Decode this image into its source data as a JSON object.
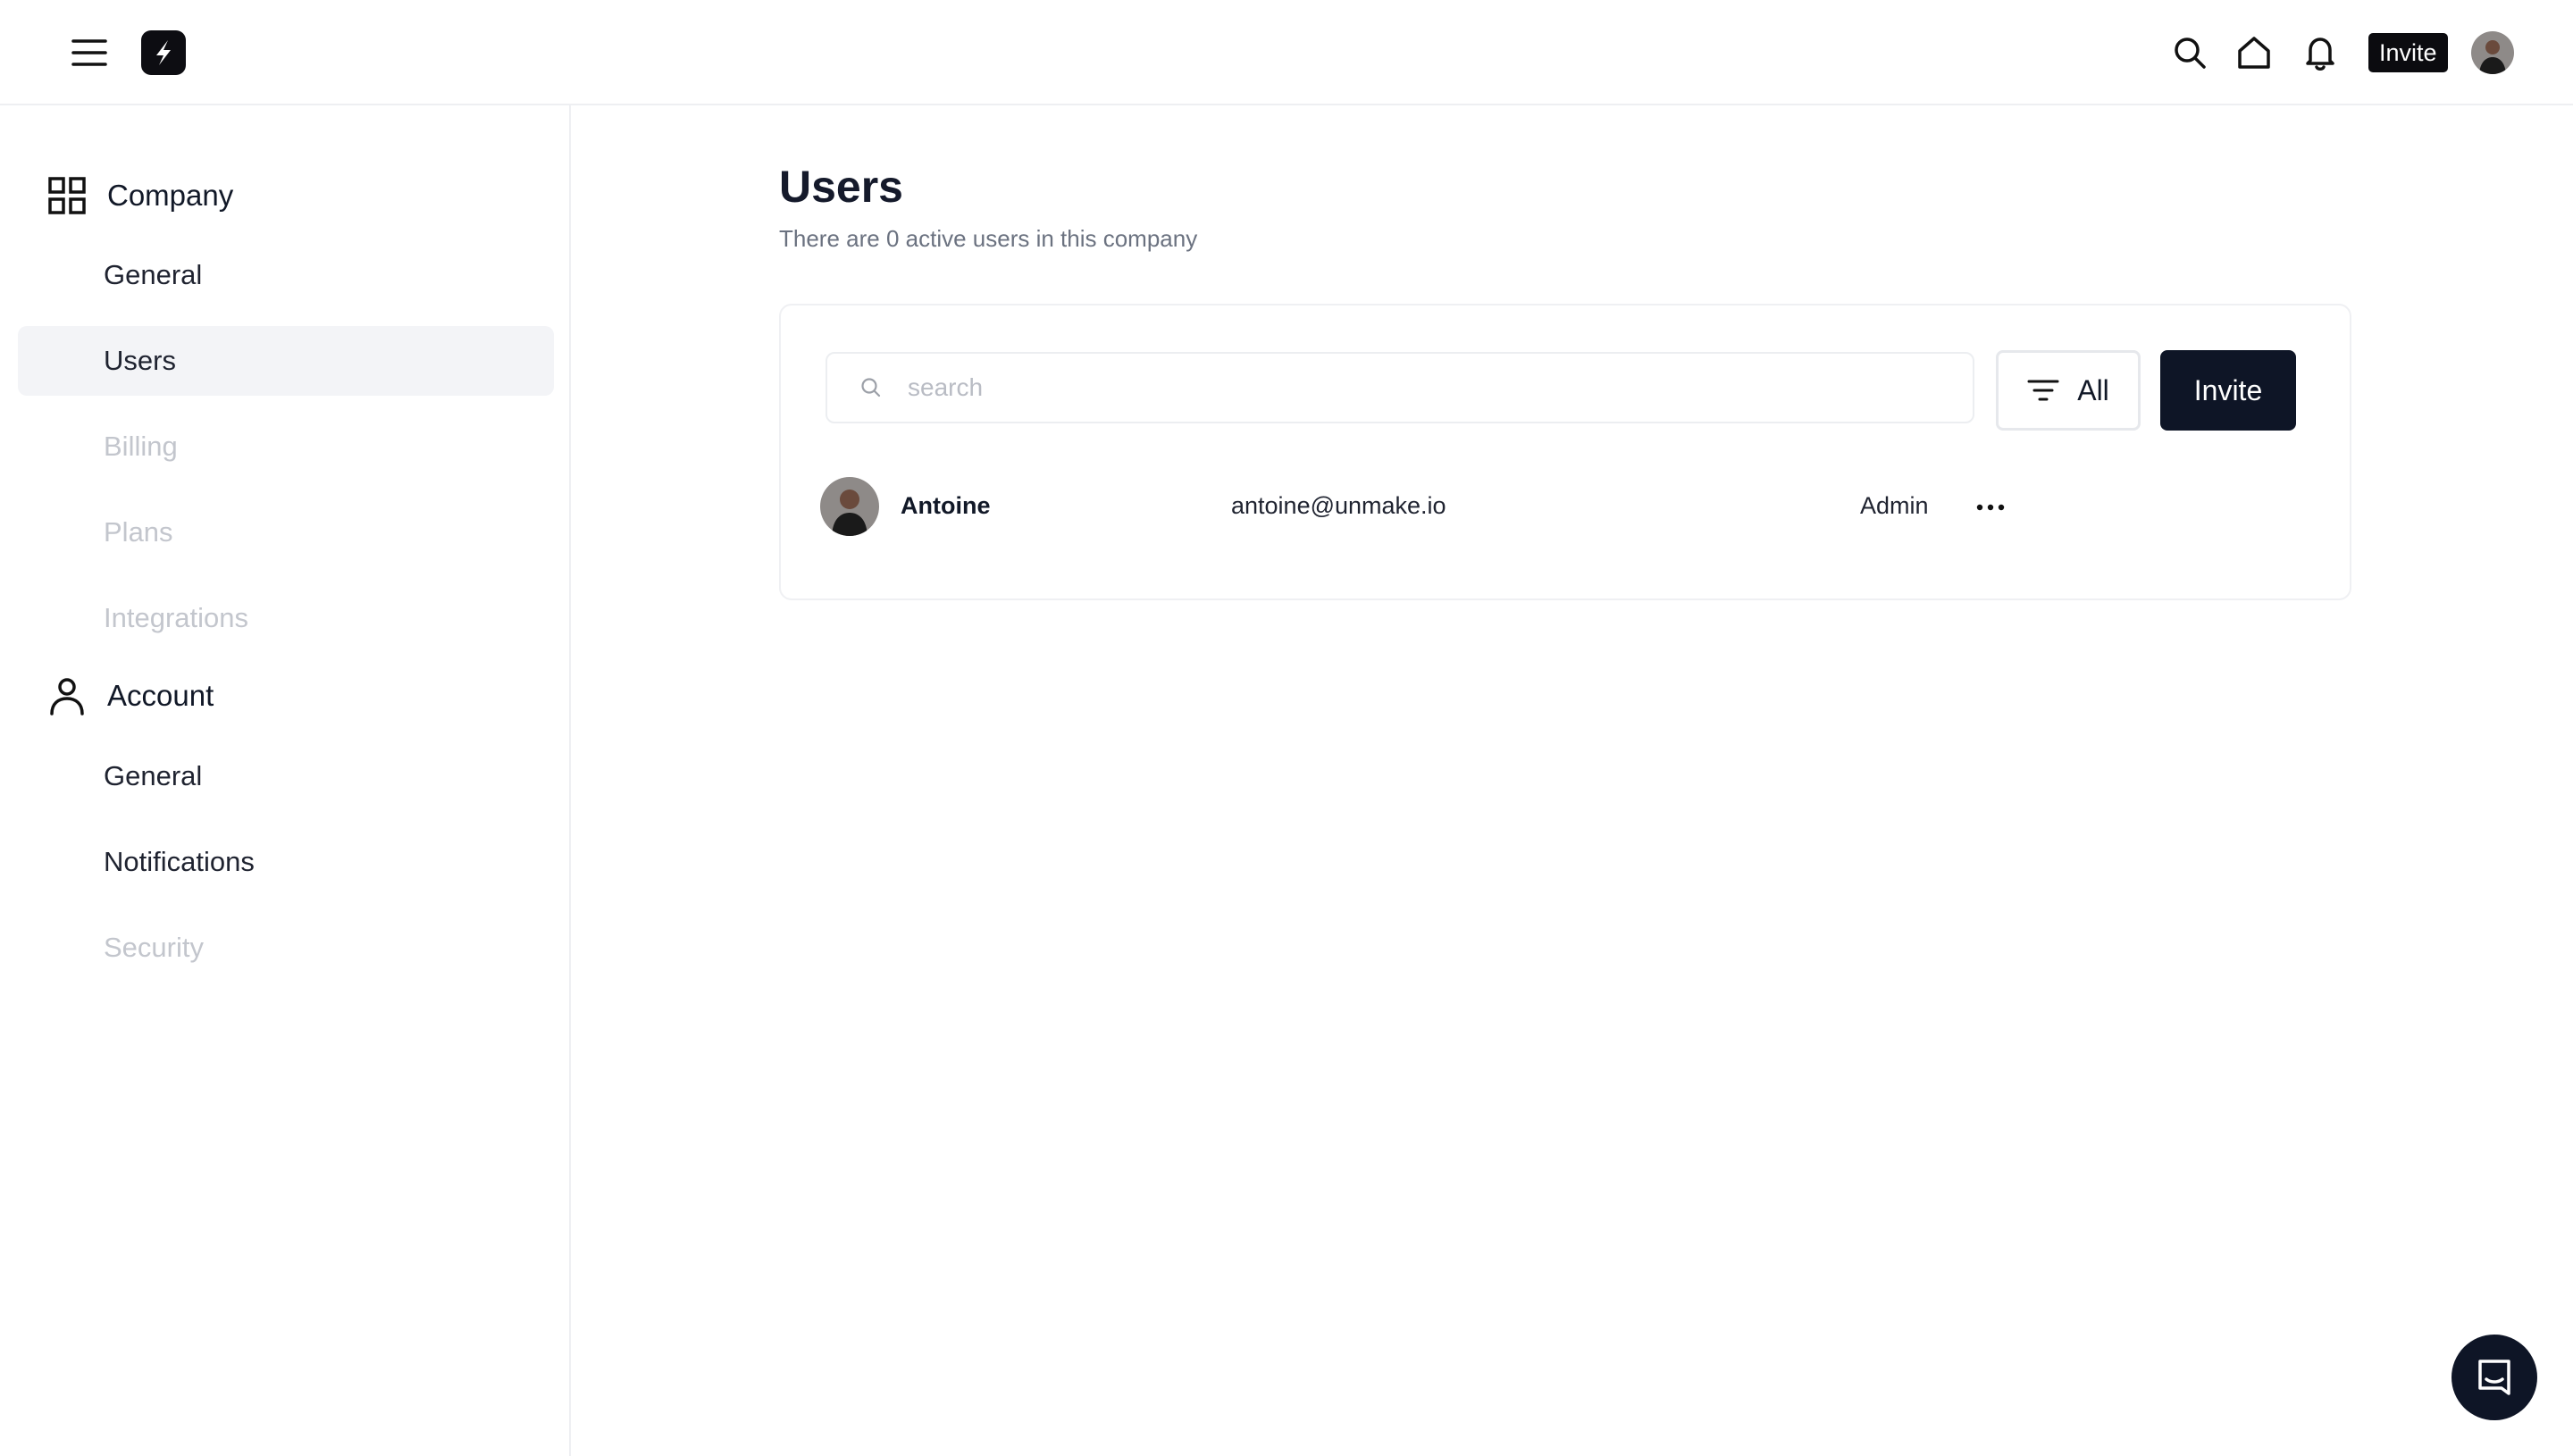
{
  "header": {
    "menu_icon": "hamburger-menu-icon",
    "logo_icon": "lightning-logo-icon",
    "icons": [
      "search-icon",
      "home-icon",
      "bell-icon"
    ],
    "invite_label": "Invite",
    "avatar_icon": "user-avatar-photo"
  },
  "sidebar": {
    "company": {
      "icon": "grid-icon",
      "label": "Company",
      "items": [
        {
          "label": "General",
          "state": "normal"
        },
        {
          "label": "Users",
          "state": "active"
        },
        {
          "label": "Billing",
          "state": "disabled"
        },
        {
          "label": "Plans",
          "state": "disabled"
        },
        {
          "label": "Integrations",
          "state": "disabled"
        }
      ]
    },
    "account": {
      "icon": "person-icon",
      "label": "Account",
      "items": [
        {
          "label": "General",
          "state": "normal"
        },
        {
          "label": "Notifications",
          "state": "normal"
        },
        {
          "label": "Security",
          "state": "disabled"
        }
      ]
    }
  },
  "main": {
    "title": "Users",
    "subtitle": "There are 0 active users in this company",
    "search": {
      "placeholder": "search",
      "value": "",
      "icon": "search-icon"
    },
    "filter": {
      "icon": "filter-icon",
      "label": "All"
    },
    "invite_label": "Invite",
    "users": [
      {
        "name": "Antoine",
        "email": "antoine@unmake.io",
        "role": "Admin",
        "more_icon": "more-horizontal-icon"
      }
    ]
  },
  "chat": {
    "icon": "chat-icon"
  },
  "colors": {
    "primary_dark": "#0e1526",
    "text": "#111827",
    "muted_text": "#6b7280",
    "disabled_text": "#c3c6cd",
    "active_bg": "#f3f4f7",
    "border": "#eeeff2"
  }
}
